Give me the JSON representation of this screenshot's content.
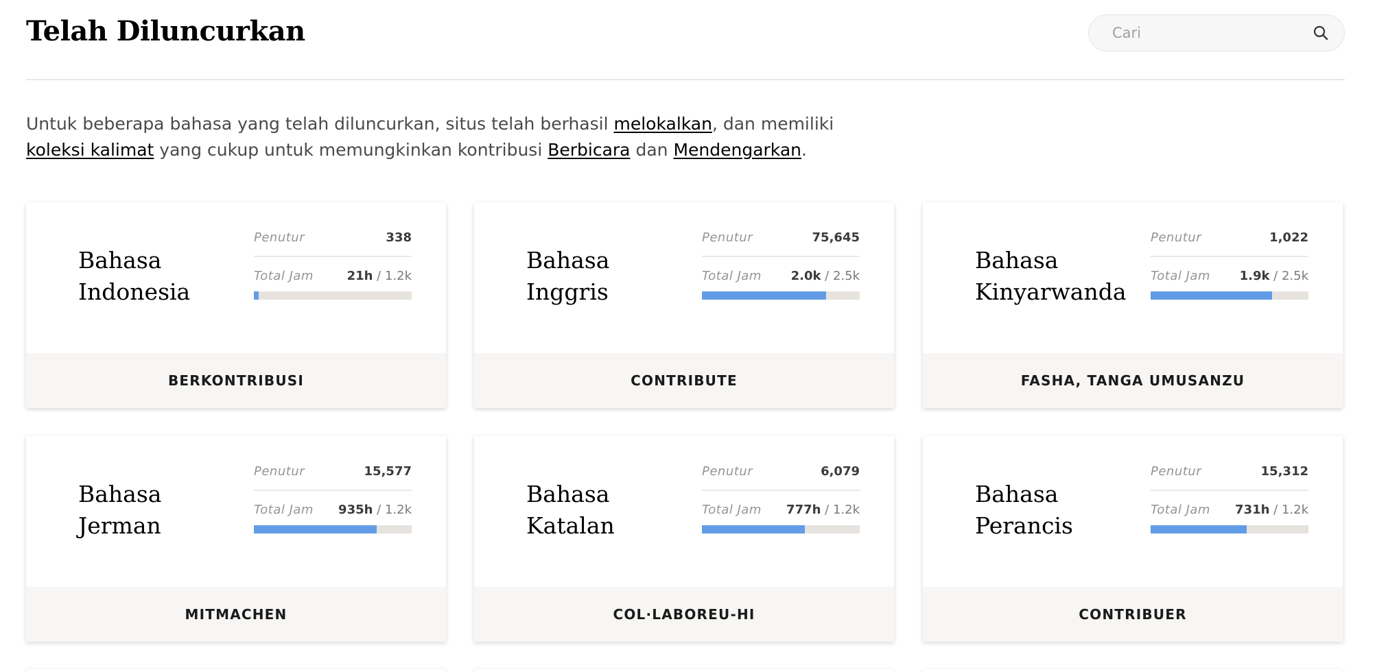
{
  "header": {
    "title": "Telah Diluncurkan",
    "search_placeholder": "Cari"
  },
  "intro": {
    "part1": "Untuk beberapa bahasa yang telah diluncurkan, situs telah berhasil ",
    "link1": "melokalkan",
    "part2": ", dan memiliki ",
    "link2": "koleksi kalimat",
    "part3": " yang cukup untuk memungkinkan kontribusi ",
    "link3": "Berbicara",
    "part4": " dan ",
    "link4": "Mendengarkan",
    "part5": "."
  },
  "stat_labels": {
    "speakers": "Penutur",
    "total_hours": "Total Jam"
  },
  "languages": [
    {
      "name": "Bahasa Indonesia",
      "speakers": "338",
      "hours": "21h",
      "goal": " / 1.2k",
      "progress": 0.03,
      "cta": "BERKONTRIBUSI"
    },
    {
      "name": "Bahasa Inggris",
      "speakers": "75,645",
      "hours": "2.0k",
      "goal": " / 2.5k",
      "progress": 0.785,
      "cta": "CONTRIBUTE"
    },
    {
      "name": "Bahasa Kinyarwanda",
      "speakers": "1,022",
      "hours": "1.9k",
      "goal": " / 2.5k",
      "progress": 0.77,
      "cta": "FASHA, TANGA UMUSANZU"
    },
    {
      "name": "Bahasa Jerman",
      "speakers": "15,577",
      "hours": "935h",
      "goal": " / 1.2k",
      "progress": 0.78,
      "cta": "MITMACHEN"
    },
    {
      "name": "Bahasa Katalan",
      "speakers": "6,079",
      "hours": "777h",
      "goal": " / 1.2k",
      "progress": 0.65,
      "cta": "COL·LABOREU-HI"
    },
    {
      "name": "Bahasa Perancis",
      "speakers": "15,312",
      "hours": "731h",
      "goal": " / 1.2k",
      "progress": 0.61,
      "cta": "CONTRIBUER"
    }
  ],
  "colors": {
    "progress_fill": "#629ce6",
    "progress_track": "#e6e3de",
    "footer_bg": "#f7f6f4"
  }
}
